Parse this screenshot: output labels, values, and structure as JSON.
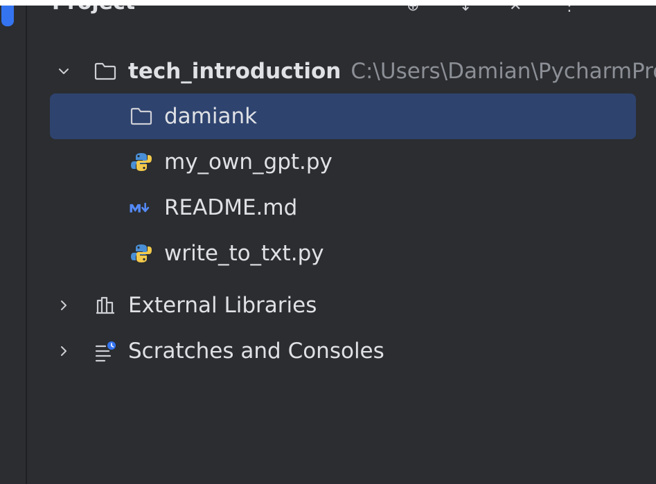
{
  "panel": {
    "title": "Project"
  },
  "tree": {
    "root": {
      "label": "tech_introduction",
      "path": "C:\\Users\\Damian\\PycharmProjects\\tech_introduction",
      "expanded": true,
      "icon": "folder-icon"
    },
    "children": [
      {
        "label": "damiank",
        "icon": "folder-icon",
        "selected": true
      },
      {
        "label": "my_own_gpt.py",
        "icon": "python-file-icon"
      },
      {
        "label": "README.md",
        "icon": "markdown-file-icon"
      },
      {
        "label": "write_to_txt.py",
        "icon": "python-file-icon"
      }
    ],
    "external_libraries": {
      "label": "External Libraries",
      "icon": "libraries-icon",
      "expanded": false
    },
    "scratches": {
      "label": "Scratches and Consoles",
      "icon": "scratches-icon",
      "expanded": false
    }
  },
  "colors": {
    "background": "#2b2d30",
    "selection": "#2e436e",
    "text": "#dfe1e5",
    "secondary_text": "#8c8f96",
    "accent": "#3574f0",
    "python_blue": "#4a8fd6",
    "python_yellow": "#f2c94c",
    "markdown_blue": "#548af7"
  }
}
